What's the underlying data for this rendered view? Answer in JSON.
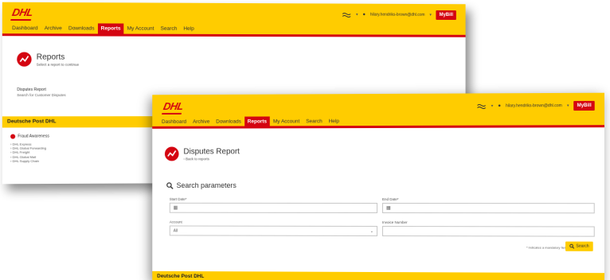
{
  "brand": {
    "logo": "DHL",
    "footer_brand": "Deutsche Post DHL",
    "accent": "#d40511",
    "primary": "#ffcc00"
  },
  "header": {
    "user_email": "hilary.hendriks-brown@dhl.com",
    "mybill": "MyBill"
  },
  "nav": {
    "dashboard": "Dashboard",
    "archive": "Archive",
    "downloads": "Downloads",
    "reports": "Reports",
    "my_account": "My Account",
    "search": "Search",
    "help": "Help"
  },
  "reports_page": {
    "title": "Reports",
    "subtitle": "Select a report to continue",
    "item_title": "Disputes Report",
    "item_sub": "Search for Customer Disputes"
  },
  "footer": {
    "fraud_label": "Fraud Awareness",
    "links": [
      "DHL Express",
      "DHL Global Forwarding",
      "DHL Freight",
      "DHL Global Mail",
      "DHL Supply Chain"
    ]
  },
  "disputes_page": {
    "title": "Disputes Report",
    "back_link": "Back to reports",
    "search_heading": "Search parameters",
    "start_date_label": "Start Date*",
    "end_date_label": "End Date*",
    "account_label": "Account",
    "account_value": "All",
    "invoice_label": "Invoice Number",
    "mandatory_note": "* indicates a mandatory field",
    "search_button": "Search"
  }
}
